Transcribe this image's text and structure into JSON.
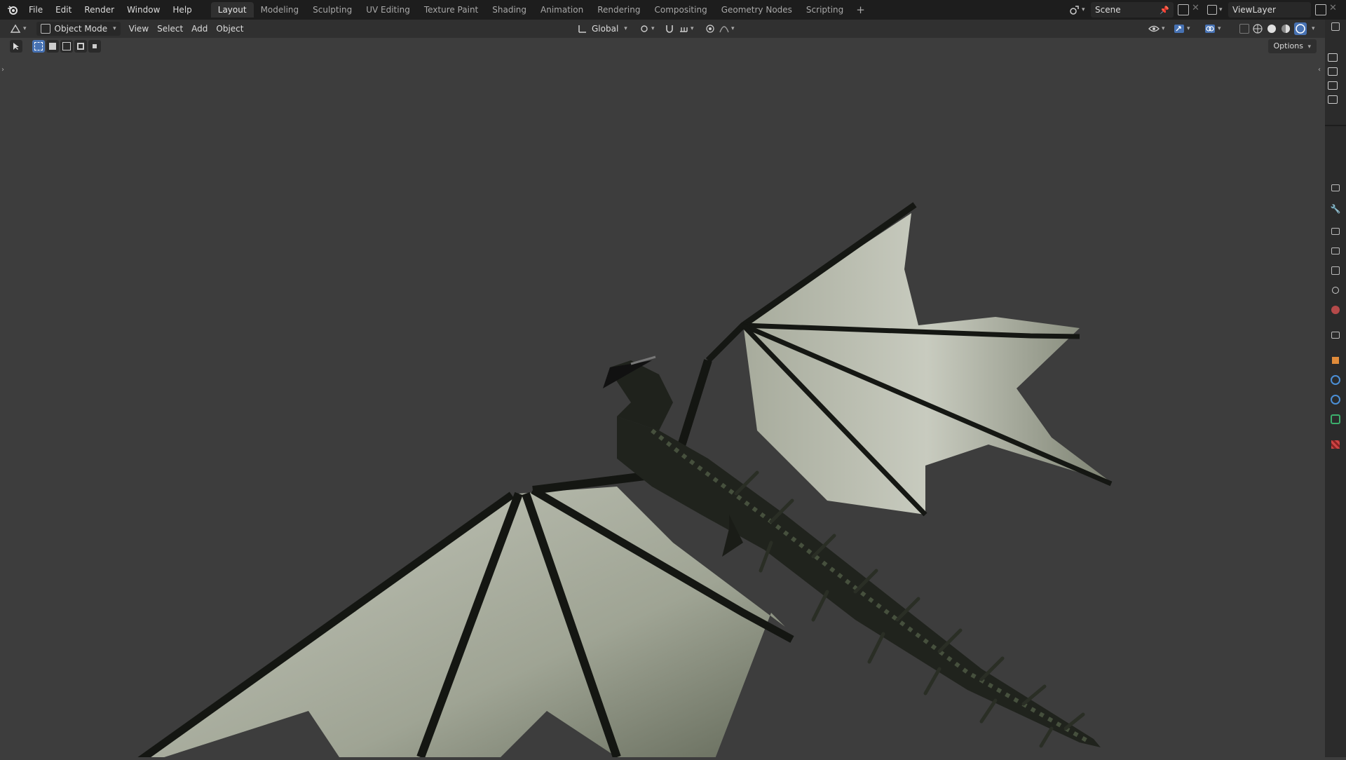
{
  "menu": [
    "File",
    "Edit",
    "Render",
    "Window",
    "Help"
  ],
  "workspaces": [
    {
      "label": "Layout",
      "active": true
    },
    {
      "label": "Modeling"
    },
    {
      "label": "Sculpting"
    },
    {
      "label": "UV Editing"
    },
    {
      "label": "Texture Paint"
    },
    {
      "label": "Shading"
    },
    {
      "label": "Animation"
    },
    {
      "label": "Rendering"
    },
    {
      "label": "Compositing"
    },
    {
      "label": "Geometry Nodes"
    },
    {
      "label": "Scripting"
    }
  ],
  "scene": {
    "name": "Scene"
  },
  "view_layer": {
    "name": "ViewLayer"
  },
  "header": {
    "mode": "Object Mode",
    "view": "View",
    "select": "Select",
    "add": "Add",
    "object": "Object",
    "orientation": "Global"
  },
  "options_label": "Options",
  "colors": {
    "background": "#3d3d3d",
    "topbar": "#1d1d1d",
    "header": "#303030",
    "accent": "#4772b3"
  }
}
